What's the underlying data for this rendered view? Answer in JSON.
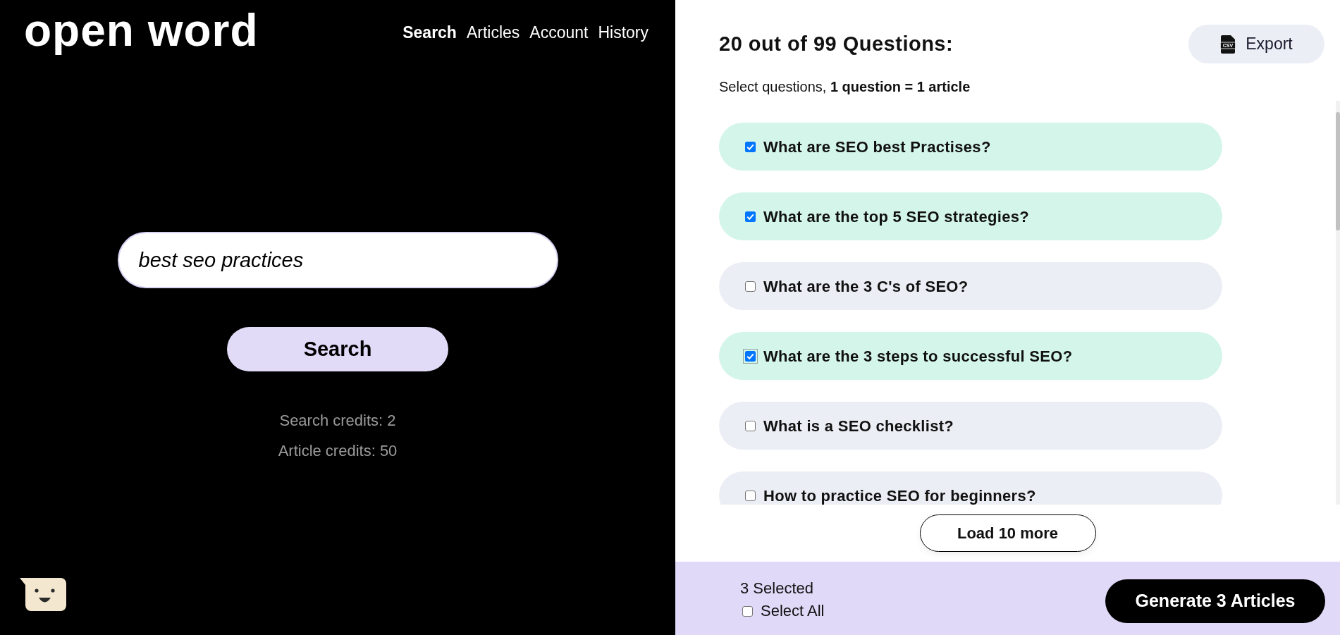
{
  "header": {
    "logo": "open word",
    "nav": [
      {
        "label": "Search",
        "selected": true
      },
      {
        "label": "Articles",
        "selected": false
      },
      {
        "label": "Account",
        "selected": false
      },
      {
        "label": "History",
        "selected": false
      }
    ]
  },
  "search": {
    "value": "best seo practices",
    "button": "Search",
    "credits": [
      "Search credits: 2",
      "Article credits: 50"
    ]
  },
  "questions_panel": {
    "title": "20 out of 99 Questions:",
    "export": {
      "icon_text": "CSV",
      "label": "Export"
    },
    "instructions": "Select questions, **1 question = 1 article**",
    "questions": [
      {
        "text": "What are SEO best Practises?",
        "checked": true,
        "focused": false
      },
      {
        "text": "What are the top 5 SEO strategies?",
        "checked": true,
        "focused": false
      },
      {
        "text": "What are the 3 C's of SEO?",
        "checked": false,
        "focused": false
      },
      {
        "text": "What are the 3 steps to successful SEO?",
        "checked": true,
        "focused": true
      },
      {
        "text": "What is a SEO checklist?",
        "checked": false,
        "focused": false
      },
      {
        "text": "How to practice SEO for beginners?",
        "checked": false,
        "focused": false
      }
    ],
    "load_more_button": "Load 10 more"
  },
  "footer": {
    "selected_count": "3 Selected",
    "select_all": {
      "label": "Select All",
      "checked": false
    },
    "generate_button": "Generate 3 Articles"
  }
}
